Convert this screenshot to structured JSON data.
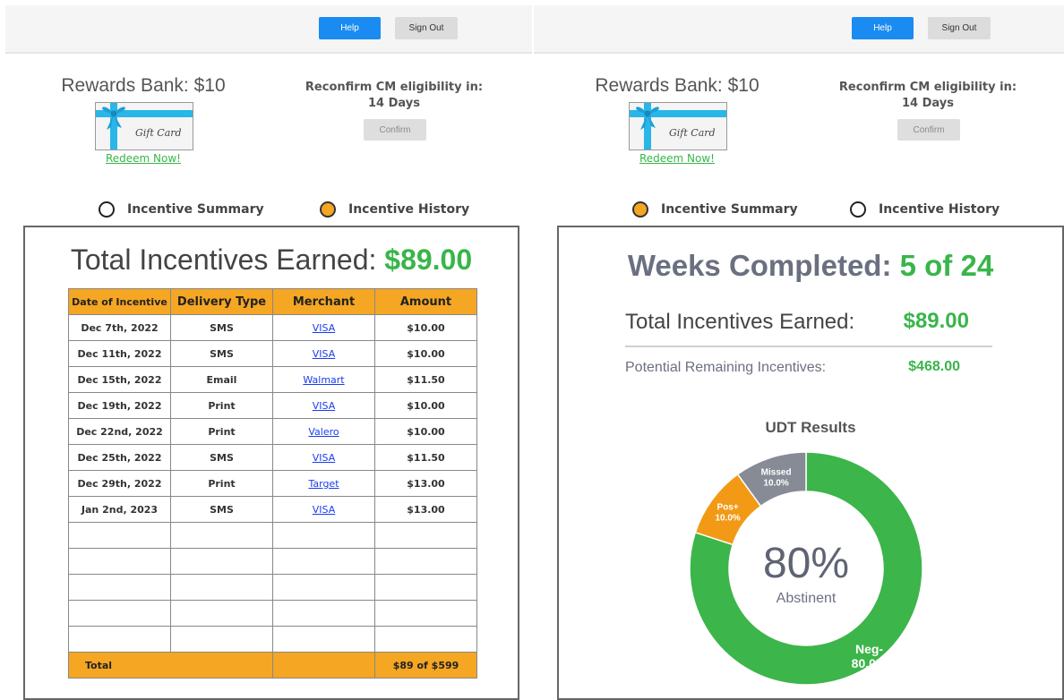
{
  "left": {
    "header": {
      "help_label": "Help",
      "signout_label": "Sign Out"
    },
    "rewards": {
      "title": "Rewards Bank: $10",
      "card_text": "Gift Card",
      "redeem_label": "Redeem Now!"
    },
    "reconfirm": {
      "line1": "Reconfirm CM eligibility in:",
      "line2": "14 Days",
      "confirm_label": "Confirm"
    },
    "tabs": [
      {
        "label": "Incentive Summary",
        "selected": false
      },
      {
        "label": "Incentive History",
        "selected": true
      }
    ],
    "history": {
      "title_prefix": "Total Incentives Earned: ",
      "title_amount": "$89.00",
      "columns": [
        "Date of Incentive",
        "Delivery Type",
        "Merchant",
        "Amount"
      ],
      "rows": [
        {
          "date": "Dec 7th, 2022",
          "type": "SMS",
          "merchant": "VISA",
          "amount": "$10.00"
        },
        {
          "date": "Dec 11th, 2022",
          "type": "SMS",
          "merchant": "VISA",
          "amount": "$10.00"
        },
        {
          "date": "Dec 15th, 2022",
          "type": "Email",
          "merchant": "Walmart",
          "amount": "$11.50"
        },
        {
          "date": "Dec 19th, 2022",
          "type": "Print",
          "merchant": "VISA",
          "amount": "$10.00"
        },
        {
          "date": "Dec 22nd, 2022",
          "type": "Print",
          "merchant": "Valero",
          "amount": "$10.00"
        },
        {
          "date": "Dec 25th, 2022",
          "type": "SMS",
          "merchant": "VISA",
          "amount": "$11.50"
        },
        {
          "date": "Dec 29th, 2022",
          "type": "Print",
          "merchant": "Target",
          "amount": "$13.00"
        },
        {
          "date": "Jan 2nd, 2023",
          "type": "SMS",
          "merchant": "VISA",
          "amount": "$13.00"
        }
      ],
      "total_label": "Total",
      "total_value": "$89 of $599"
    }
  },
  "right": {
    "header": {
      "help_label": "Help",
      "signout_label": "Sign Out"
    },
    "rewards": {
      "title": "Rewards Bank: $10",
      "card_text": "Gift Card",
      "redeem_label": "Redeem Now!"
    },
    "reconfirm": {
      "line1": "Reconfirm CM eligibility in:",
      "line2": "14 Days",
      "confirm_label": "Confirm"
    },
    "tabs": [
      {
        "label": "Incentive Summary",
        "selected": true
      },
      {
        "label": "Incentive History",
        "selected": false
      }
    ],
    "summary": {
      "weeks_prefix": "Weeks Completed: ",
      "weeks_value": "5 of 24",
      "earned_label": "Total Incentives Earned:",
      "earned_value": "$89.00",
      "potential_label": "Potential Remaining Incentives:",
      "potential_value": "$468.00"
    },
    "chart_data": {
      "type": "pie",
      "title": "UDT Results",
      "center_value": "80%",
      "center_label": "Abstinent",
      "slices": [
        {
          "name": "Neg-",
          "value": 80.0,
          "label": "80.0%",
          "color": "#3cb54a"
        },
        {
          "name": "Pos+",
          "value": 10.0,
          "label": "10.0%",
          "color": "#f29a16"
        },
        {
          "name": "Missed",
          "value": 10.0,
          "label": "10.0%",
          "color": "#868b96"
        }
      ]
    }
  },
  "colors": {
    "accent": "#1a8bf0",
    "green": "#39b54a",
    "orange": "#f5a623"
  }
}
